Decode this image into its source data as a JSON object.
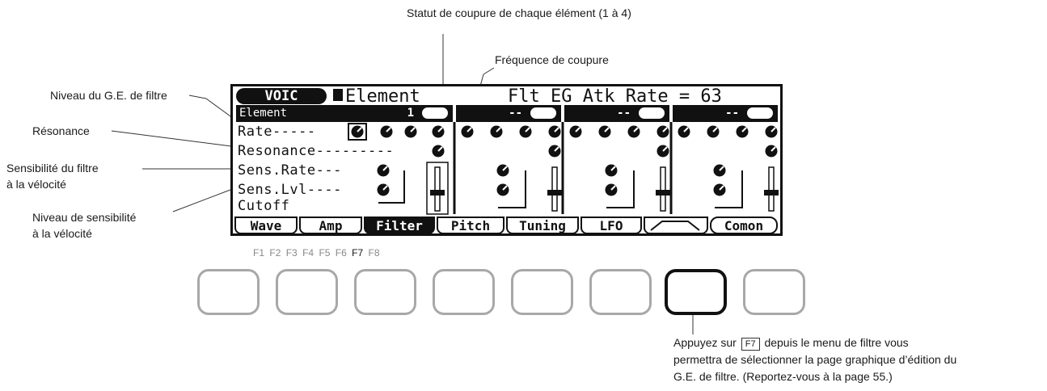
{
  "annotations": {
    "cutoff_status": "Statut de coupure de chaque élément (1 à 4)",
    "cutoff_freq": "Fréquence de coupure",
    "filter_eg_level": "Niveau du G.E. de filtre",
    "resonance": "Résonance",
    "vel_sens_line1": "Sensibilité du filtre",
    "vel_sens_line2": "à la vélocité",
    "vel_level_line1": "Niveau de sensibilité",
    "vel_level_line2": "à la vélocité"
  },
  "lcd": {
    "mode": "VOIC",
    "title": "Element",
    "param": "Flt EG Atk Rate = 63",
    "element_label": "Element",
    "element_num": "1",
    "other_num": "--",
    "rows": [
      "Rate-----",
      "Resonance---------",
      "Sens.Rate---",
      "Sens.Lvl----",
      "Cutoff"
    ],
    "tabs": [
      {
        "label": "Wave"
      },
      {
        "label": "Amp"
      },
      {
        "label": "Filter"
      },
      {
        "label": "Pitch"
      },
      {
        "label": "Tuning"
      },
      {
        "label": "LFO"
      },
      {
        "label": ""
      },
      {
        "label": "Comon"
      }
    ]
  },
  "fkeys": [
    "F1",
    "F2",
    "F3",
    "F4",
    "F5",
    "F6",
    "F7",
    "F8"
  ],
  "active_fkey": "F7",
  "note": {
    "line1_a": "Appuyez sur",
    "key": "F7",
    "line1_b": "depuis le menu de filtre vous",
    "line2": "permettra de sélectionner la page graphique d’édition du",
    "line3": "G.E. de filtre. (Reportez-vous à la page 55.)"
  },
  "colors": {
    "ink": "#111111",
    "inactive_button": "#a8a8a8",
    "fkey_inactive": "#888888"
  }
}
